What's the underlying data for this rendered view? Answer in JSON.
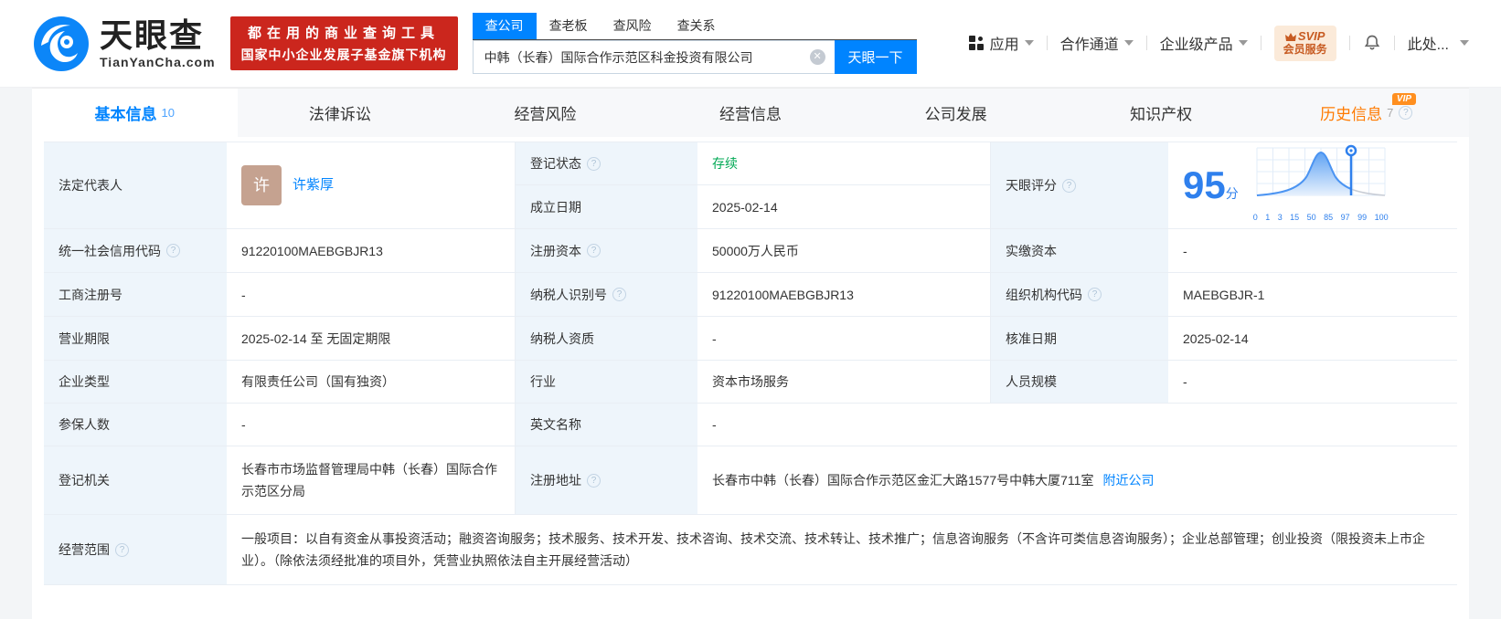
{
  "header": {
    "logo": {
      "title": "天眼查",
      "domain": "TianYanCha.com"
    },
    "promo": {
      "line1": "都在用的商业查询工具",
      "line2": "国家中小企业发展子基金旗下机构"
    },
    "search": {
      "tabs": [
        {
          "label": "查公司"
        },
        {
          "label": "查老板"
        },
        {
          "label": "查风险"
        },
        {
          "label": "查关系"
        }
      ],
      "value": "中韩（长春）国际合作示范区科金投资有限公司",
      "button": "天眼一下"
    },
    "nav": {
      "apps": "应用",
      "partner": "合作通道",
      "enterprise": "企业级产品",
      "svip_top": "SVIP",
      "svip_bottom": "会员服务",
      "more": "此处..."
    }
  },
  "tabs": [
    {
      "label": "基本信息",
      "count": "10"
    },
    {
      "label": "法律诉讼"
    },
    {
      "label": "经营风险"
    },
    {
      "label": "经营信息"
    },
    {
      "label": "公司发展"
    },
    {
      "label": "知识产权"
    },
    {
      "label": "历史信息",
      "count": "7",
      "vip": "VIP"
    }
  ],
  "profile": {
    "legal_rep": {
      "label": "法定代表人",
      "avatar": "许",
      "name": "许紫厚"
    },
    "reg_status": {
      "label": "登记状态",
      "value": "存续"
    },
    "establish_date": {
      "label": "成立日期",
      "value": "2025-02-14"
    },
    "score": {
      "label": "天眼评分",
      "value": "95",
      "unit": "分"
    },
    "credit_code": {
      "label": "统一社会信用代码",
      "value": "91220100MAEBGBJR13"
    },
    "reg_capital": {
      "label": "注册资本",
      "value": "50000万人民币"
    },
    "paid_capital": {
      "label": "实缴资本",
      "value": "-"
    },
    "reg_number": {
      "label": "工商注册号",
      "value": "-"
    },
    "taxpayer_id": {
      "label": "纳税人识别号",
      "value": "91220100MAEBGBJR13"
    },
    "org_code": {
      "label": "组织机构代码",
      "value": "MAEBGBJR-1"
    },
    "business_term": {
      "label": "营业期限",
      "value": "2025-02-14 至 无固定期限"
    },
    "taxpayer_quality": {
      "label": "纳税人资质",
      "value": "-"
    },
    "approval_date": {
      "label": "核准日期",
      "value": "2025-02-14"
    },
    "company_type": {
      "label": "企业类型",
      "value": "有限责任公司（国有独资）"
    },
    "industry": {
      "label": "行业",
      "value": "资本市场服务"
    },
    "staff_size": {
      "label": "人员规模",
      "value": "-"
    },
    "insured_count": {
      "label": "参保人数",
      "value": "-"
    },
    "english_name": {
      "label": "英文名称",
      "value": "-"
    },
    "reg_authority": {
      "label": "登记机关",
      "value": "长春市市场监督管理局中韩（长春）国际合作示范区分局"
    },
    "reg_address": {
      "label": "注册地址",
      "value": "长春市中韩（长春）国际合作示范区金汇大路1577号中韩大厦711室",
      "link": "附近公司"
    },
    "business_scope": {
      "label": "经营范围",
      "value": "一般项目：以自有资金从事投资活动；融资咨询服务；技术服务、技术开发、技术咨询、技术交流、技术转让、技术推广；信息咨询服务（不含许可类信息咨询服务）；企业总部管理；创业投资（限投资未上市企业）。（除依法须经批准的项目外，凭营业执照依法自主开展经营活动）"
    }
  },
  "chart_data": {
    "type": "area",
    "title": "天眼评分",
    "score": 95,
    "score_unit": "分",
    "x_ticks": [
      "0",
      "1",
      "3",
      "15",
      "50",
      "85",
      "97",
      "99",
      "100"
    ],
    "marker_value": 95,
    "curve_shape": "bell distribution peaked at tick 50, blue filled up to marker at 95, gray tail after",
    "accent_color": "#2f80ed",
    "grid": true
  },
  "colors": {
    "brand_blue": "#0084ff",
    "score_blue": "#2f80ed",
    "promo_red": "#cb261d",
    "status_green": "#00a854",
    "history_orange": "#ff7a00",
    "label_bg": "#eef5fb",
    "avatar_tan": "#c5a290"
  }
}
